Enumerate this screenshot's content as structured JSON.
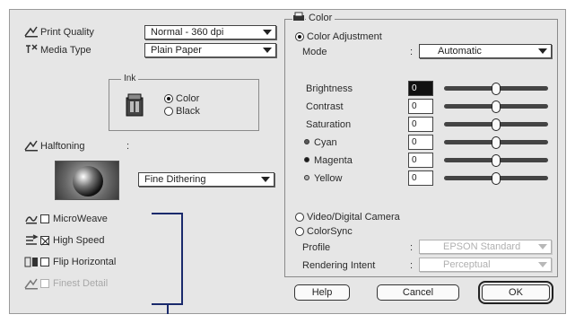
{
  "left": {
    "print_quality": {
      "label": "Print Quality",
      "value": "Normal - 360 dpi"
    },
    "media_type": {
      "label": "Media Type",
      "value": "Plain Paper"
    },
    "ink": {
      "label": "Ink",
      "options": [
        "Color",
        "Black"
      ],
      "selected": "Color"
    },
    "halftoning": {
      "label": "Halftoning",
      "value": "Fine Dithering"
    },
    "checkboxes": [
      {
        "label": "MicroWeave",
        "checked": false,
        "enabled": true
      },
      {
        "label": "High Speed",
        "checked": true,
        "enabled": true
      },
      {
        "label": "Flip Horizontal",
        "checked": false,
        "enabled": true
      },
      {
        "label": "Finest Detail",
        "checked": false,
        "enabled": false
      }
    ]
  },
  "color": {
    "title": "Color",
    "adjustment_label": "Color Adjustment",
    "mode_label": "Mode",
    "mode_value": "Automatic",
    "sliders": [
      {
        "label": "Brightness",
        "value": "0",
        "level": 0.5
      },
      {
        "label": "Contrast",
        "value": "0",
        "level": 0.5
      },
      {
        "label": "Saturation",
        "value": "0",
        "level": 0.5
      },
      {
        "label": "Cyan",
        "value": "0",
        "level": 0.5
      },
      {
        "label": "Magenta",
        "value": "0",
        "level": 0.5
      },
      {
        "label": "Yellow",
        "value": "0",
        "level": 0.5
      }
    ],
    "video_label": "Video/Digital Camera",
    "colorsync_label": "ColorSync",
    "profile_label": "Profile",
    "profile_value": "EPSON Standard",
    "rendering_label": "Rendering Intent",
    "rendering_value": "Perceptual",
    "dot_colors": {
      "cyan": "#5a5a5a",
      "magenta": "#1a1a1a",
      "yellow": "#b0b0b0"
    }
  },
  "buttons": {
    "help": "Help",
    "cancel": "Cancel",
    "ok": "OK"
  },
  "colors": {
    "window_bg": "#e6e6e6",
    "callout": "#1a2a6c"
  }
}
